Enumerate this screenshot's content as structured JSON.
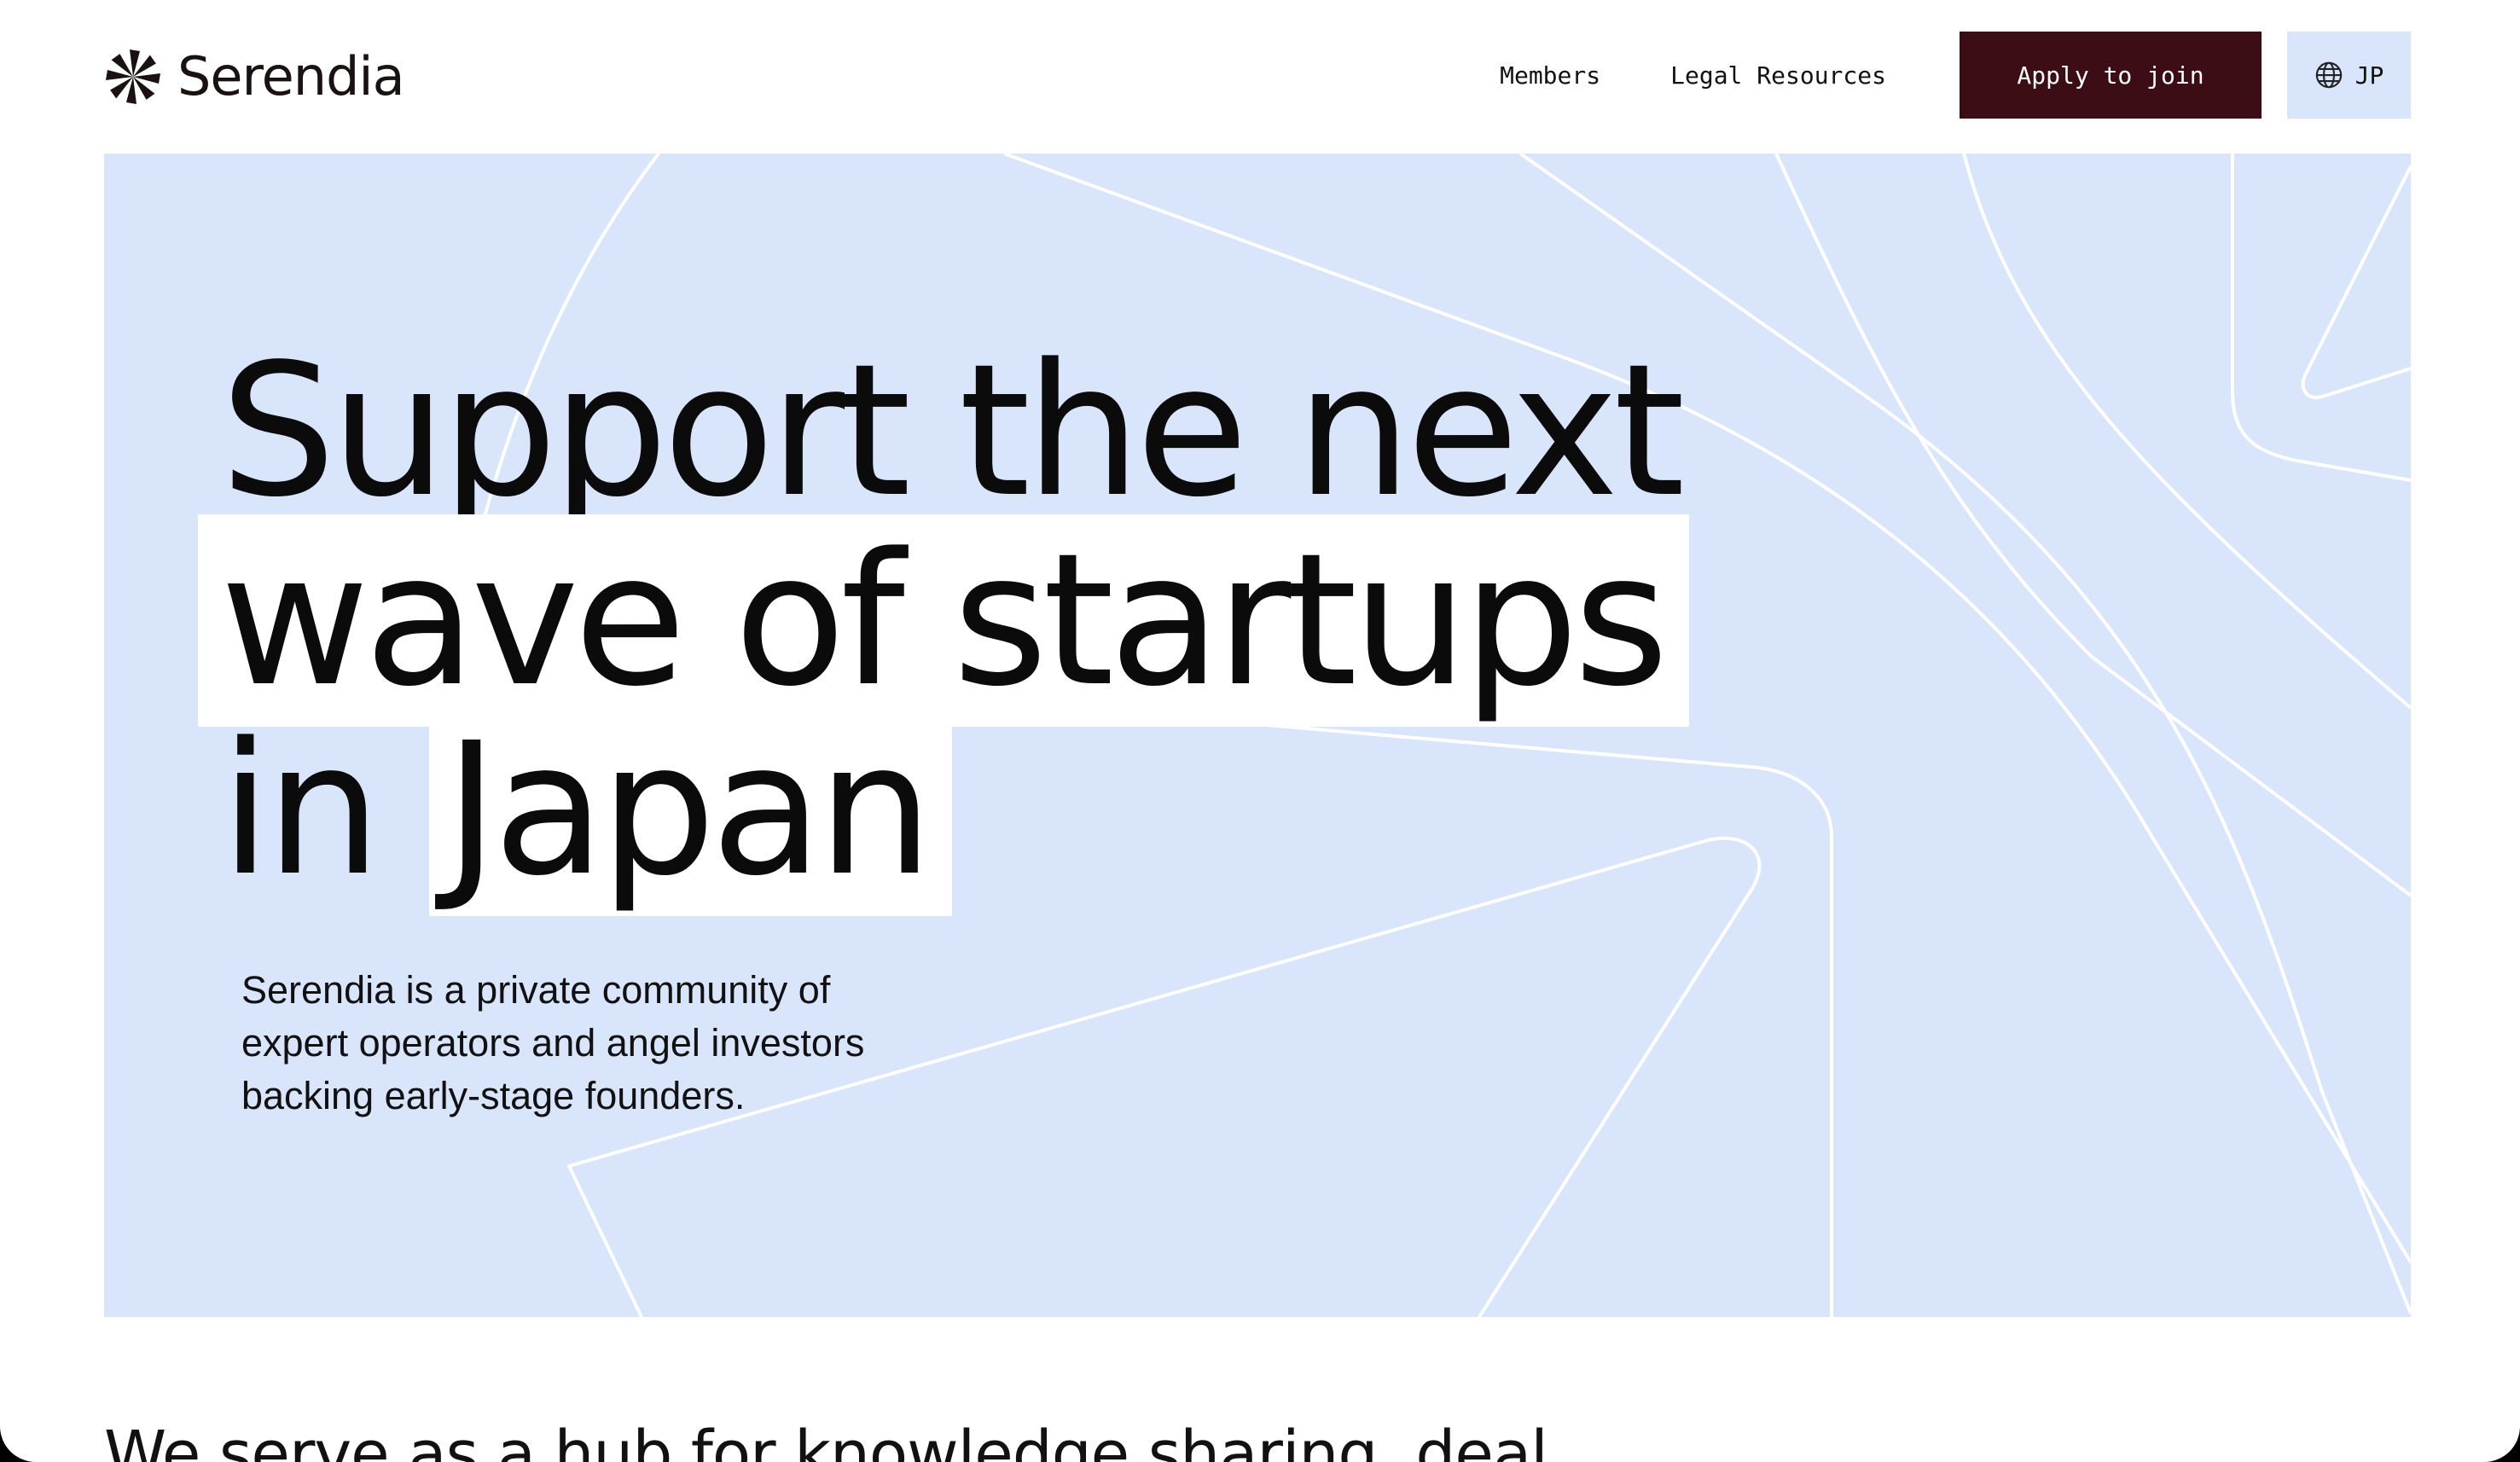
{
  "brand": {
    "name": "Serendia",
    "logo_icon": "pinwheel-icon"
  },
  "nav": {
    "items": [
      {
        "label": "Members"
      },
      {
        "label": "Legal Resources"
      }
    ],
    "apply_label": "Apply to join",
    "language": {
      "icon": "globe-icon",
      "label": "JP"
    }
  },
  "hero": {
    "headline": {
      "line1": "Support the next",
      "line2": "wave of startups",
      "line3_prefix": "in",
      "line3_highlight": "Japan"
    },
    "description": "Serendia is a private community of expert operators and angel investors backing early-stage founders."
  },
  "next_section": {
    "heading_partial": "We serve as a hub for knowledge sharing, deal"
  },
  "colors": {
    "accent_button": "#3d0d16",
    "hero_background": "#d9e5fb",
    "highlight": "#ffffff",
    "text": "#111111"
  }
}
